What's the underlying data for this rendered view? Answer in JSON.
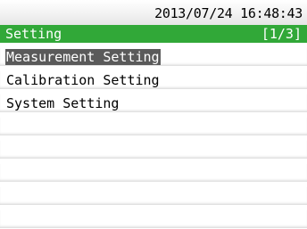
{
  "datetime": "2013/07/24 16:48:43",
  "header": {
    "title": "Setting",
    "page": "[1/3]"
  },
  "menu": {
    "items": [
      {
        "label": "Measurement Setting",
        "selected": true
      },
      {
        "label": "Calibration Setting",
        "selected": false
      },
      {
        "label": "System Setting",
        "selected": false
      }
    ]
  },
  "colors": {
    "title_bar": "#31a838",
    "selection_highlight": "#5a5a5a"
  }
}
